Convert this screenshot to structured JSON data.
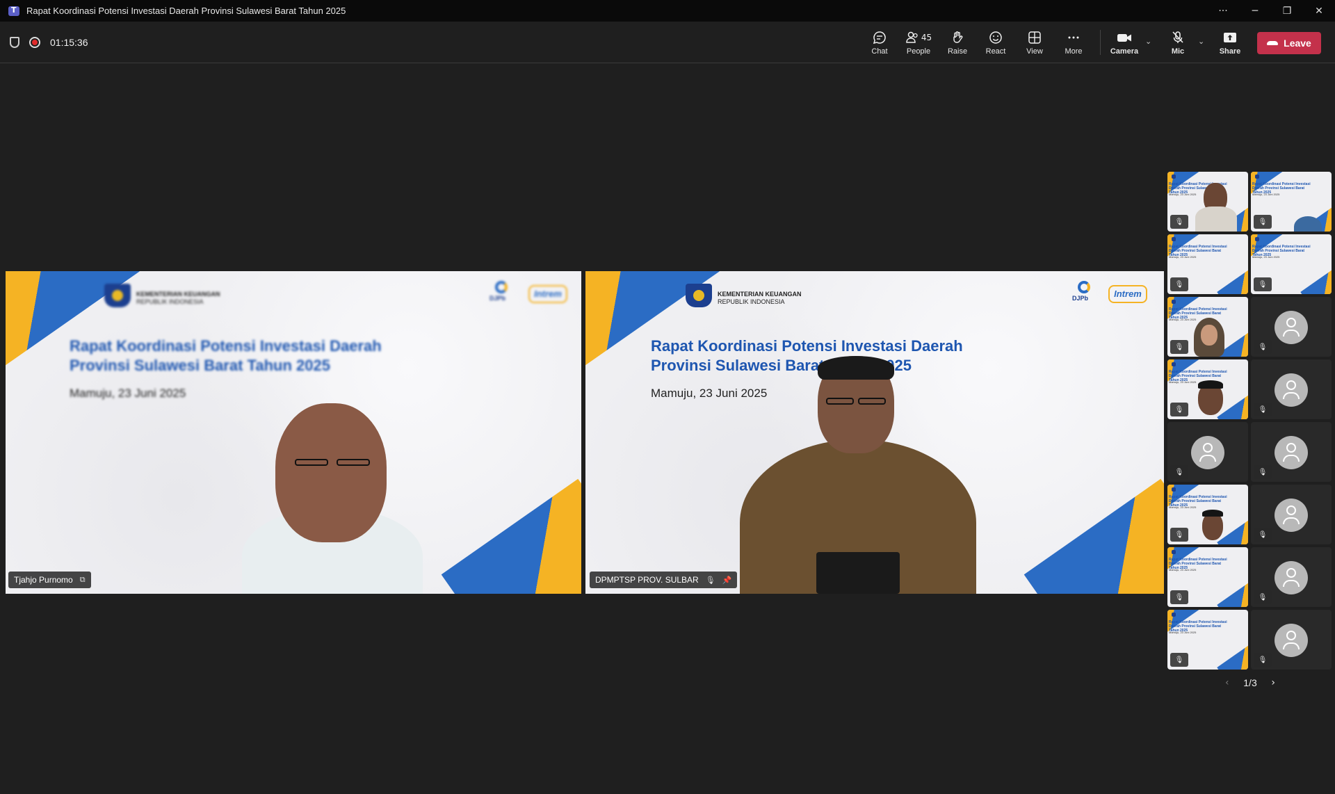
{
  "window": {
    "title": "Rapat Koordinasi Potensi Investasi Daerah Provinsi Sulawesi Barat Tahun 2025",
    "controls": [
      "···",
      "─",
      "❐",
      "✕"
    ]
  },
  "toolbar": {
    "timer": "01:15:36",
    "chat_label": "Chat",
    "people_label": "People",
    "people_count": "45",
    "raise_label": "Raise",
    "react_label": "React",
    "view_label": "View",
    "more_label": "More",
    "camera_label": "Camera",
    "mic_label": "Mic",
    "share_label": "Share",
    "leave_label": "Leave"
  },
  "slide": {
    "ministry": "KEMENTERIAN KEUANGAN",
    "ministry_sub": "REPUBLIK INDONESIA",
    "logo_a": "DJPb",
    "logo_b": "Intrem",
    "title_line1": "Rapat Koordinasi Potensi Investasi Daerah",
    "title_line2": "Provinsi Sulawesi Barat Tahun 2025",
    "date": "Mamuju, 23 Juni 2025",
    "mini_title": "Rapat Koordinasi Potensi Investasi Daerah Provinsi Sulawesi Barat Tahun 2025",
    "mini_date": "Mamuju, 23 Juni 2025"
  },
  "stage": {
    "left_name": "Tjahjo Purnomo",
    "right_name": "DPMPTSP PROV. SULBAR"
  },
  "pager": {
    "label": "1/3"
  },
  "colors": {
    "accent": "#7f85f5",
    "leave": "#c4314b",
    "slide_blue": "#1e56b0",
    "slide_yellow": "#f5b324"
  }
}
